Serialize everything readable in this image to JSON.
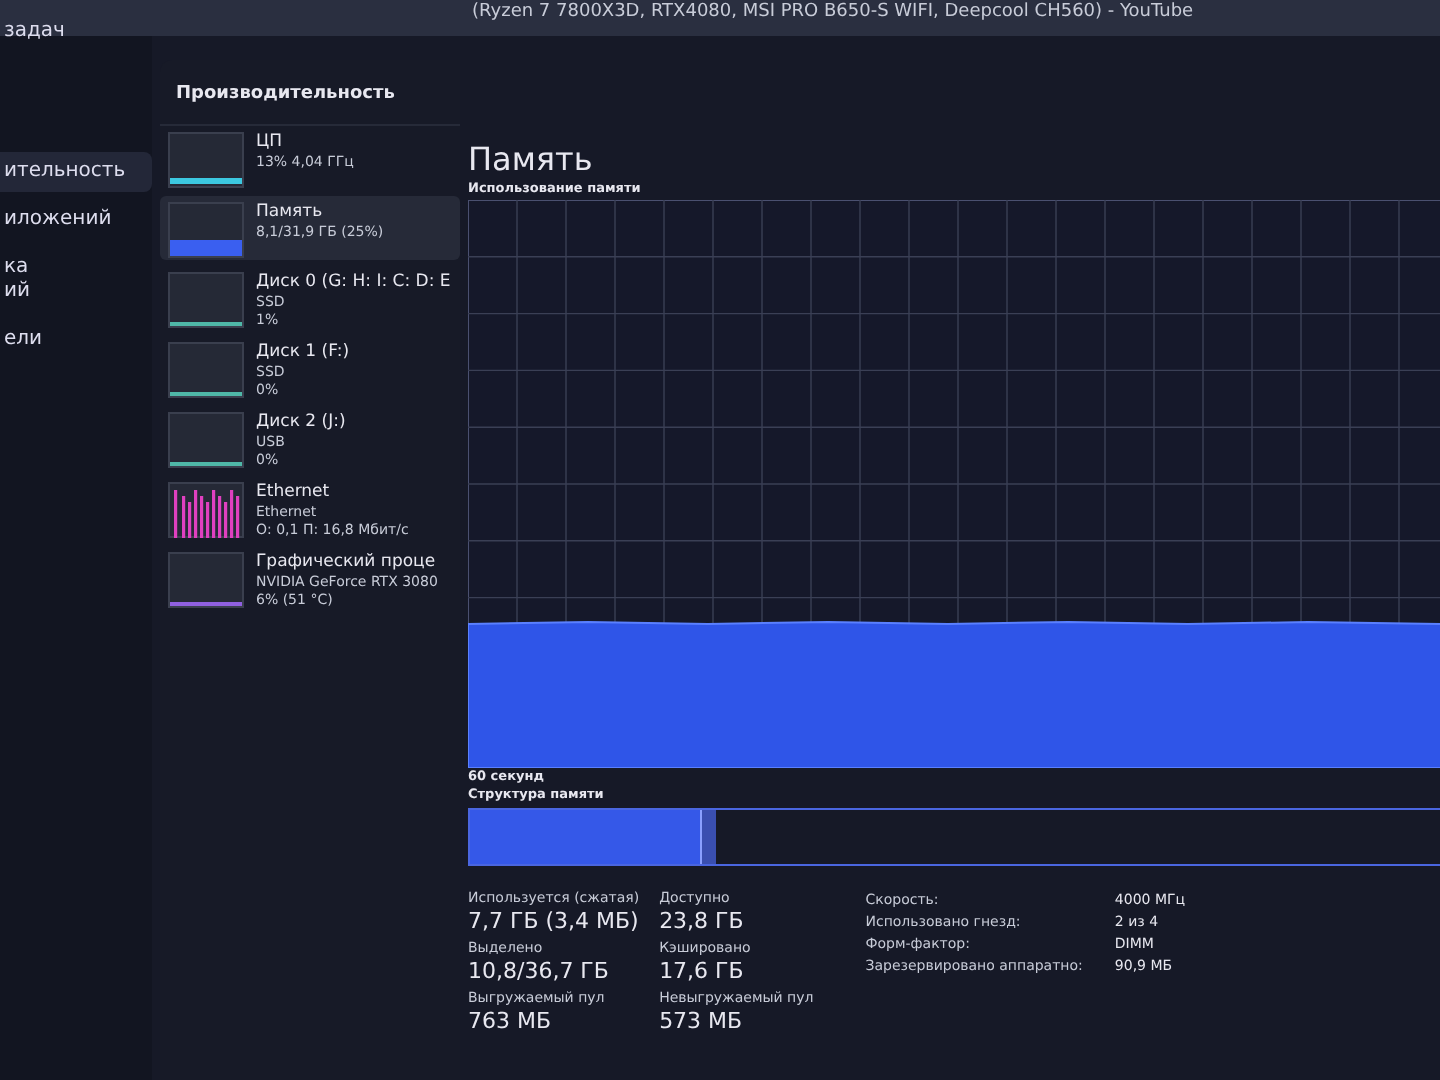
{
  "window": {
    "title": "(Ryzen 7 7800X3D, RTX4080, MSI PRO B650-S WIFI, Deepcool CH560) - YouTube"
  },
  "nav": {
    "items": [
      {
        "label": "задач",
        "selected": false
      },
      {
        "label": "ительность",
        "selected": true
      },
      {
        "label": "иложений",
        "selected": false
      },
      {
        "label": "ка\nий",
        "selected": false
      },
      {
        "label": "ели",
        "selected": false
      }
    ]
  },
  "perf_list": {
    "title": "Производительность",
    "items": [
      {
        "kind": "cpu",
        "name": "ЦП",
        "lines": [
          "13% 4,04 ГГц"
        ],
        "selected": false,
        "color": "#3cc8e0"
      },
      {
        "kind": "memory",
        "name": "Память",
        "lines": [
          "8,1/31,9 ГБ (25%)"
        ],
        "selected": true,
        "color": "#3a5ff0"
      },
      {
        "kind": "disk",
        "name": "Диск 0 (G: H: I: C: D: E",
        "lines": [
          "SSD",
          "1%"
        ],
        "selected": false,
        "color": "#4fb8a8"
      },
      {
        "kind": "disk",
        "name": "Диск 1 (F:)",
        "lines": [
          "SSD",
          "0%"
        ],
        "selected": false,
        "color": "#4fb8a8"
      },
      {
        "kind": "disk",
        "name": "Диск 2 (J:)",
        "lines": [
          "USB",
          "0%"
        ],
        "selected": false,
        "color": "#4fb8a8"
      },
      {
        "kind": "network",
        "name": "Ethernet",
        "lines": [
          "Ethernet",
          "О: 0,1 П: 16,8 Мбит/с"
        ],
        "selected": false,
        "color": "#e040c0"
      },
      {
        "kind": "gpu",
        "name": "Графический проце",
        "lines": [
          "NVIDIA GeForce RTX 3080",
          "6% (51 °C)"
        ],
        "selected": false,
        "color": "#9060e0"
      }
    ]
  },
  "memory": {
    "title": "Память",
    "usage_label": "Использование памяти",
    "time_label": "60 секунд",
    "structure_label": "Структура памяти",
    "stats": [
      {
        "label": "Используется (сжатая)",
        "value": "7,7 ГБ (3,4 МБ)"
      },
      {
        "label": "Доступно",
        "value": "23,8 ГБ"
      },
      {
        "label": "Выделено",
        "value": "10,8/36,7 ГБ"
      },
      {
        "label": "Кэшировано",
        "value": "17,6 ГБ"
      },
      {
        "label": "Выгружаемый пул",
        "value": "763 МБ"
      },
      {
        "label": "Невыгружаемый пул",
        "value": "573 МБ"
      }
    ],
    "details": [
      {
        "label": "Скорость:",
        "value": "4000 МГц"
      },
      {
        "label": "Использовано гнезд:",
        "value": "2 из 4"
      },
      {
        "label": "Форм-фактор:",
        "value": "DIMM"
      },
      {
        "label": "Зарезервировано аппаратно:",
        "value": "90,9 МБ"
      }
    ]
  }
}
